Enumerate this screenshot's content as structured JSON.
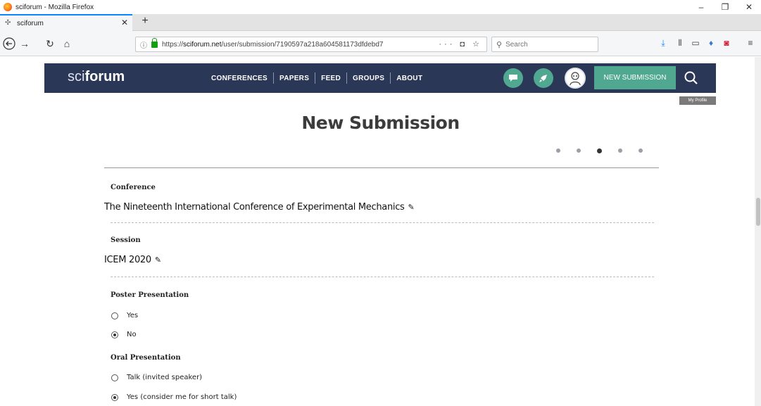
{
  "window": {
    "title": "sciforum - Mozilla Firefox",
    "minimize": "–",
    "restore": "❐",
    "close": "✕"
  },
  "tabs": {
    "active_label": "sciforum",
    "close_glyph": "✕",
    "new_tab_glyph": "+"
  },
  "navbar": {
    "url_prefix": "https://",
    "url_domain": "sciforum.net",
    "url_path": "/user/submission/7190597a218a604581173dfdebd7",
    "url_actions": "··· ◘ ☆",
    "search_placeholder": "Search"
  },
  "site": {
    "logo_thin": "sci",
    "logo_bold": "forum",
    "nav": [
      "CONFERENCES",
      "PAPERS",
      "FEED",
      "GROUPS",
      "ABOUT"
    ],
    "new_submission_label": "NEW SUBMISSION",
    "tooltip": "My Profile"
  },
  "page": {
    "title": "New Submission",
    "steps_total": 5,
    "steps_active_index": 2
  },
  "form": {
    "conference_label": "Conference",
    "conference_value": "The Nineteenth International Conference of Experimental Mechanics",
    "session_label": "Session",
    "session_value": "ICEM 2020",
    "poster_label": "Poster Presentation",
    "poster_options": [
      {
        "label": "Yes",
        "checked": false
      },
      {
        "label": "No",
        "checked": true
      }
    ],
    "oral_label": "Oral Presentation",
    "oral_options": [
      {
        "label": "Talk (invited speaker)",
        "checked": false
      },
      {
        "label": "Yes (consider me for short talk)",
        "checked": true
      }
    ]
  },
  "icons": {
    "back": "back-arrow-icon",
    "forward": "forward-arrow-icon",
    "reload": "reload-icon",
    "home": "home-icon",
    "edit": "pencil-icon"
  },
  "colors": {
    "header_bg": "#2b3756",
    "accent_green": "#4fa88f",
    "tab_accent": "#0a84ff"
  }
}
